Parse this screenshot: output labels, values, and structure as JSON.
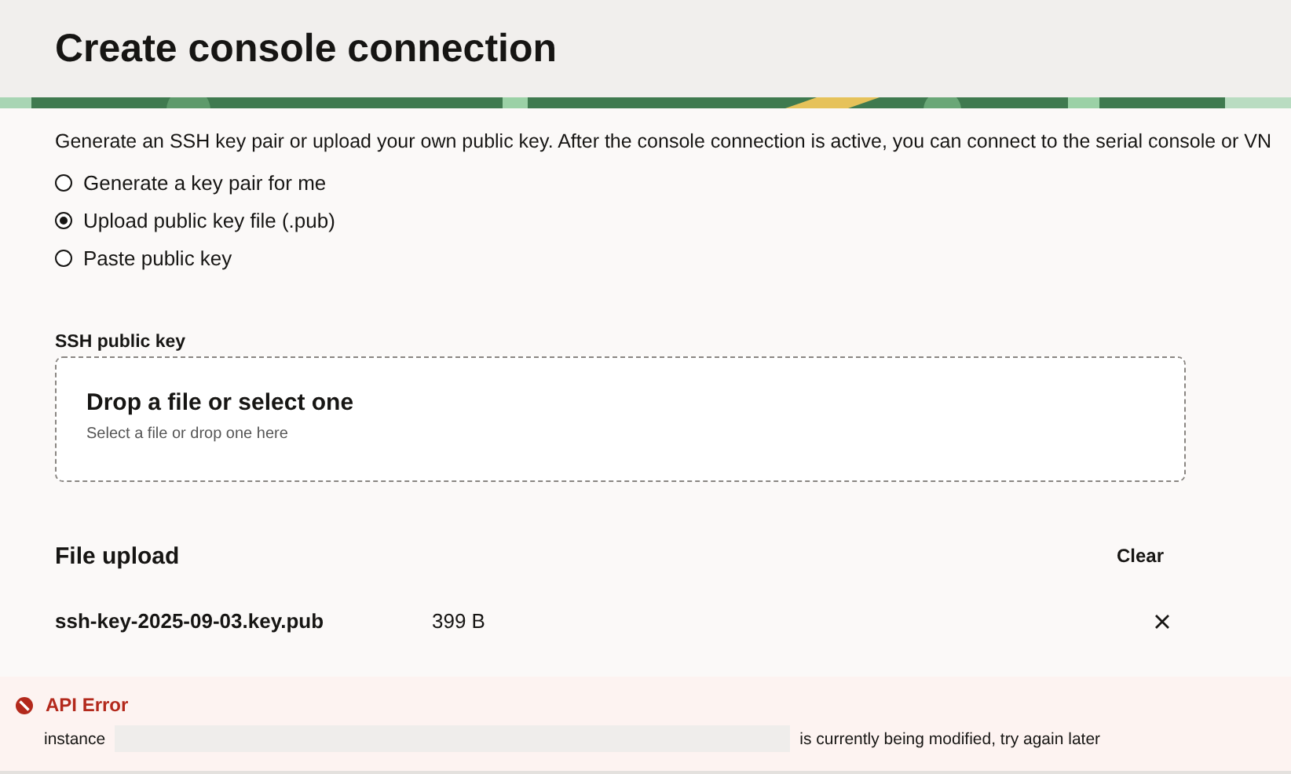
{
  "header": {
    "title": "Create console connection"
  },
  "description": "Generate an SSH key pair or upload your own public key. After the console connection is active, you can connect to the serial console or VN",
  "key_options": [
    {
      "label": "Generate a key pair for me",
      "selected": false
    },
    {
      "label": "Upload public key file (.pub)",
      "selected": true
    },
    {
      "label": "Paste public key",
      "selected": false
    }
  ],
  "ssh_public_key": {
    "label": "SSH public key",
    "dropzone_title": "Drop a file or select one",
    "dropzone_hint": "Select a file or drop one here"
  },
  "file_upload": {
    "title": "File upload",
    "clear_button": "Clear",
    "files": [
      {
        "name": "ssh-key-2025-09-03.key.pub",
        "size": "399 B"
      }
    ]
  },
  "error": {
    "title": "API Error",
    "message_start": "instance",
    "message_end": "is currently being modified, try again later"
  }
}
